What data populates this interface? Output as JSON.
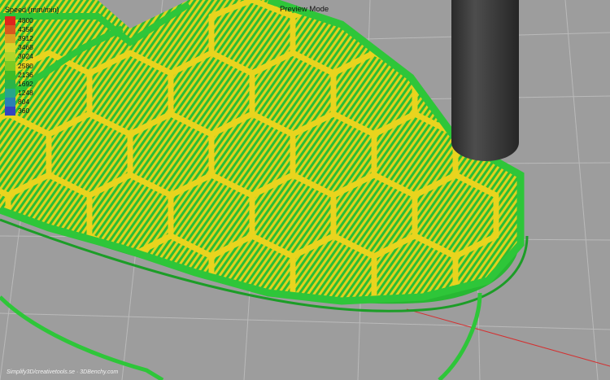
{
  "app": {
    "mode_label": "Preview Mode",
    "credit": "Simplify3D/creativetools.se  ·  3DBenchy.com"
  },
  "legend": {
    "title": "Speed (mm/min)",
    "entries": [
      {
        "label": "4800",
        "color": "#e0241c"
      },
      {
        "label": "4356",
        "color": "#d8581f"
      },
      {
        "label": "3912",
        "color": "#d9a321"
      },
      {
        "label": "3468",
        "color": "#d7d42b"
      },
      {
        "label": "3024",
        "color": "#b1d52a"
      },
      {
        "label": "2580",
        "color": "#7acb23"
      },
      {
        "label": "2136",
        "color": "#3dbc27"
      },
      {
        "label": "1692",
        "color": "#2bb447"
      },
      {
        "label": "1248",
        "color": "#27a58a"
      },
      {
        "label": "804",
        "color": "#2b80b4"
      },
      {
        "label": "360",
        "color": "#3443c0"
      }
    ]
  },
  "colors": {
    "background": "#9a9a9a",
    "grid_line": "#bdbdbd",
    "infill_yellow": "#e3cf1c",
    "perimeter_green": "#2fc43a",
    "nozzle": "#3a3a3a"
  }
}
